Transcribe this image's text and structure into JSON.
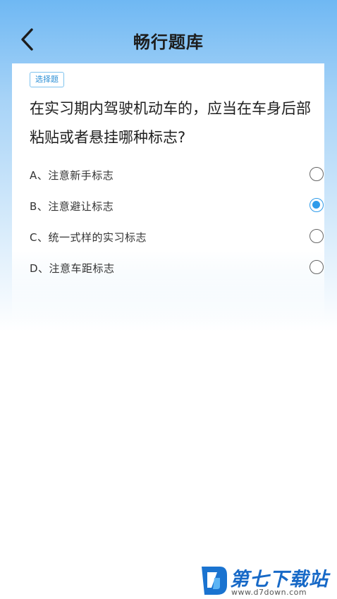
{
  "header": {
    "back_icon": "chevron-left-icon",
    "title": "畅行题库"
  },
  "question": {
    "type_tag": "选择题",
    "text": "在实习期内驾驶机动车的，应当在车身后部粘贴或者悬挂哪种标志?",
    "options": [
      {
        "label": "A、注意新手标志",
        "selected": false
      },
      {
        "label": "B、注意避让标志",
        "selected": true
      },
      {
        "label": "C、统一式样的实习标志",
        "selected": false
      },
      {
        "label": "D、注意车距标志",
        "selected": false
      }
    ]
  },
  "watermark": {
    "brand": "第七下载站",
    "url": "www.d7down.com"
  },
  "colors": {
    "accent": "#2e9bea",
    "header_gradient_top": "#6fb8f3",
    "brand": "#1769c7"
  }
}
